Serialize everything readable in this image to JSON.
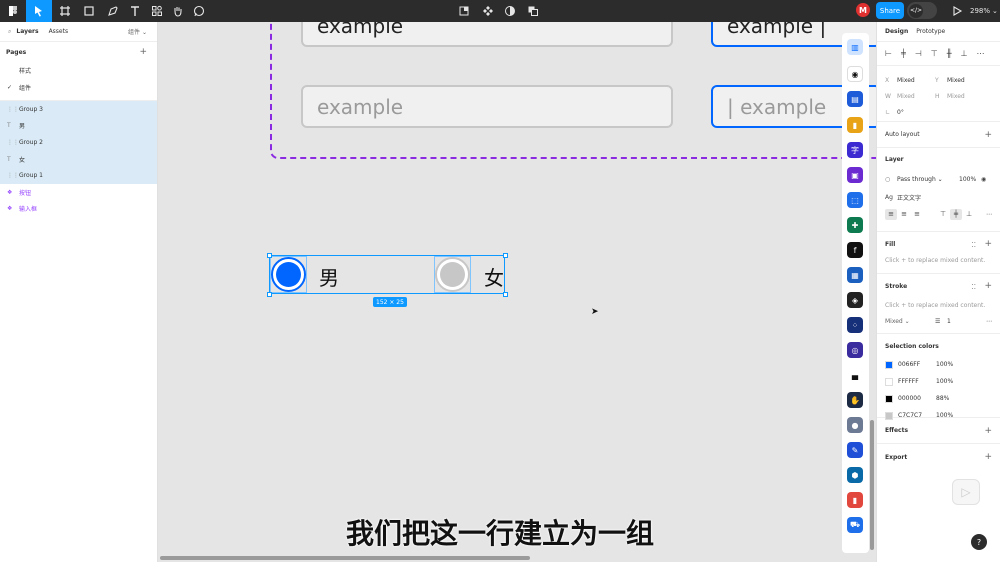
{
  "toolbar": {
    "avatar_initial": "M",
    "share_label": "Share",
    "dev_mode_label": "</>",
    "zoom": "298%",
    "icons": [
      "main-menu-icon",
      "move-tool-icon",
      "frame-tool-icon",
      "shape-tool-icon",
      "pen-tool-icon",
      "text-tool-icon",
      "resources-icon",
      "hand-tool-icon",
      "comment-icon",
      "crop-icon",
      "component-icon",
      "mask-icon",
      "boolean-icon",
      "present-icon"
    ]
  },
  "left_panel": {
    "tabs": [
      "Layers",
      "Assets"
    ],
    "page_switch": "组件",
    "pages_title": "Pages",
    "pages": [
      {
        "label": "样式",
        "current": false
      },
      {
        "label": "组件",
        "current": true
      }
    ],
    "layers": [
      {
        "label": "Group 3",
        "type": "group",
        "selected": true
      },
      {
        "label": "男",
        "type": "text",
        "selected": true
      },
      {
        "label": "Group 2",
        "type": "group",
        "selected": true
      },
      {
        "label": "女",
        "type": "text",
        "selected": true
      },
      {
        "label": "Group 1",
        "type": "group",
        "selected": true
      },
      {
        "label": "按钮",
        "type": "component",
        "selected": false
      },
      {
        "label": "输入框",
        "type": "component",
        "selected": false
      }
    ]
  },
  "canvas": {
    "inputs": [
      {
        "text": "example",
        "state": "filled"
      },
      {
        "text": "example |",
        "state": "focused-filled"
      },
      {
        "text": "example",
        "state": "placeholder"
      },
      {
        "text": "| example",
        "state": "focused-placeholder"
      }
    ],
    "radios": [
      {
        "label": "男",
        "checked": true
      },
      {
        "label": "女",
        "checked": false
      }
    ],
    "selection_size": "152 × 25",
    "subtitle": "我们把这一行建立为一组"
  },
  "right_panel": {
    "tabs": [
      "Design",
      "Prototype"
    ],
    "x_label": "X",
    "x_value": "Mixed",
    "y_label": "Y",
    "y_value": "Mixed",
    "w_label": "W",
    "w_value": "Mixed",
    "h_label": "H",
    "h_value": "Mixed",
    "rotation": "0°",
    "auto_layout": "Auto layout",
    "layer_title": "Layer",
    "blend_mode": "Pass through",
    "opacity": "100%",
    "text_style": "正文文字",
    "fill_title": "Fill",
    "fill_hint": "Click + to replace mixed content.",
    "stroke_title": "Stroke",
    "stroke_hint": "Click + to replace mixed content.",
    "stroke_position": "Mixed",
    "stroke_weight": "1",
    "selection_colors_title": "Selection colors",
    "selection_colors": [
      {
        "hex": "0066FF",
        "opacity": "100%",
        "color": "#0066ff"
      },
      {
        "hex": "FFFFFF",
        "opacity": "100%",
        "color": "#ffffff"
      },
      {
        "hex": "000000",
        "opacity": "88%",
        "color": "#000000"
      },
      {
        "hex": "C7C7C7",
        "opacity": "100%",
        "color": "#c7c7c7"
      }
    ],
    "effects_title": "Effects",
    "export_title": "Export"
  },
  "help_label": "?",
  "colors": {
    "accent": "#0d99ff",
    "primary": "#0066ff",
    "component": "#9747ff",
    "border_gray": "#c7c7c7"
  }
}
